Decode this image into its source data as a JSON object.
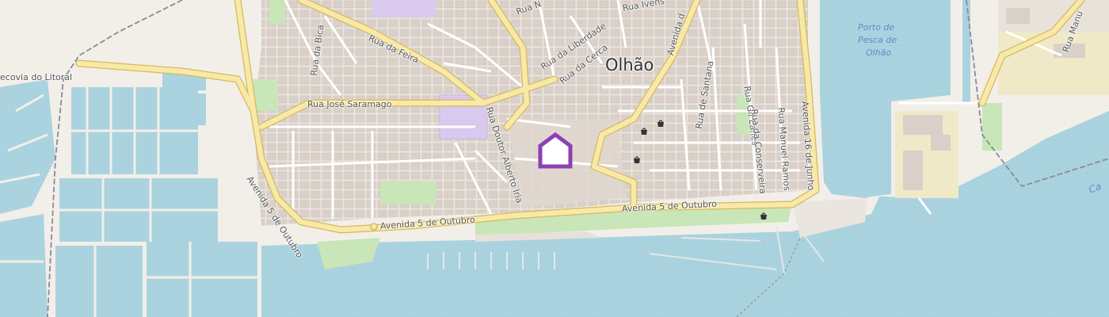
{
  "map": {
    "colors": {
      "land": "#f2efe9",
      "water": "#aad3df",
      "road_major": "#f7e9a8",
      "road_major_casing": "#e7c978",
      "road_minor": "#ffffff",
      "building": "#d9d0c9",
      "park": "#c8e6b7",
      "school": "#d9c9ef",
      "marker": "#8e3fb5",
      "railway": "#8a8a9a"
    },
    "town_label": "Olhão",
    "harbor_label": [
      "Porto de",
      "Pesca de",
      "Olhão"
    ],
    "channel_label": "Ca",
    "streets": {
      "rua_ivens": "Rua Ivens",
      "rua_n": "Rua N",
      "rua_da_liberdade": "Rua da Liberdade",
      "rua_da_cerca": "Rua da Cerca",
      "rua_da_bica": "Rua da Bica",
      "rua_da_feira": "Rua da Feira",
      "rua_jose_saramago": "Rua José Saramago",
      "ecovia": "ecovia do Litoral",
      "rua_doutor_alberto_iria": "Rua Doutor Alberto Iria",
      "avenida_5_outubro_west": "Avenida 5 de Outubro",
      "avenida_5_outubro_south": "Avenida 5 de Outubro",
      "avenida_5_outubro_east": "Avenida 5 de Outubro",
      "avenida_r": "Avenida d",
      "rua_de_santana": "Rua de Santana",
      "rua_gil_eanes": "Rua Gil Eanes",
      "rua_da_conserveira": "Rua da Conserveira",
      "rua_manuel_ramos": "Rua Manuel Ramos",
      "avenida_16_junho": "Avenida 16 de Junho",
      "rua_manu": "Rua Manu"
    },
    "icons": [
      "home-marker-icon",
      "shop-icon",
      "shop-icon",
      "shop-icon",
      "shop-icon"
    ]
  }
}
